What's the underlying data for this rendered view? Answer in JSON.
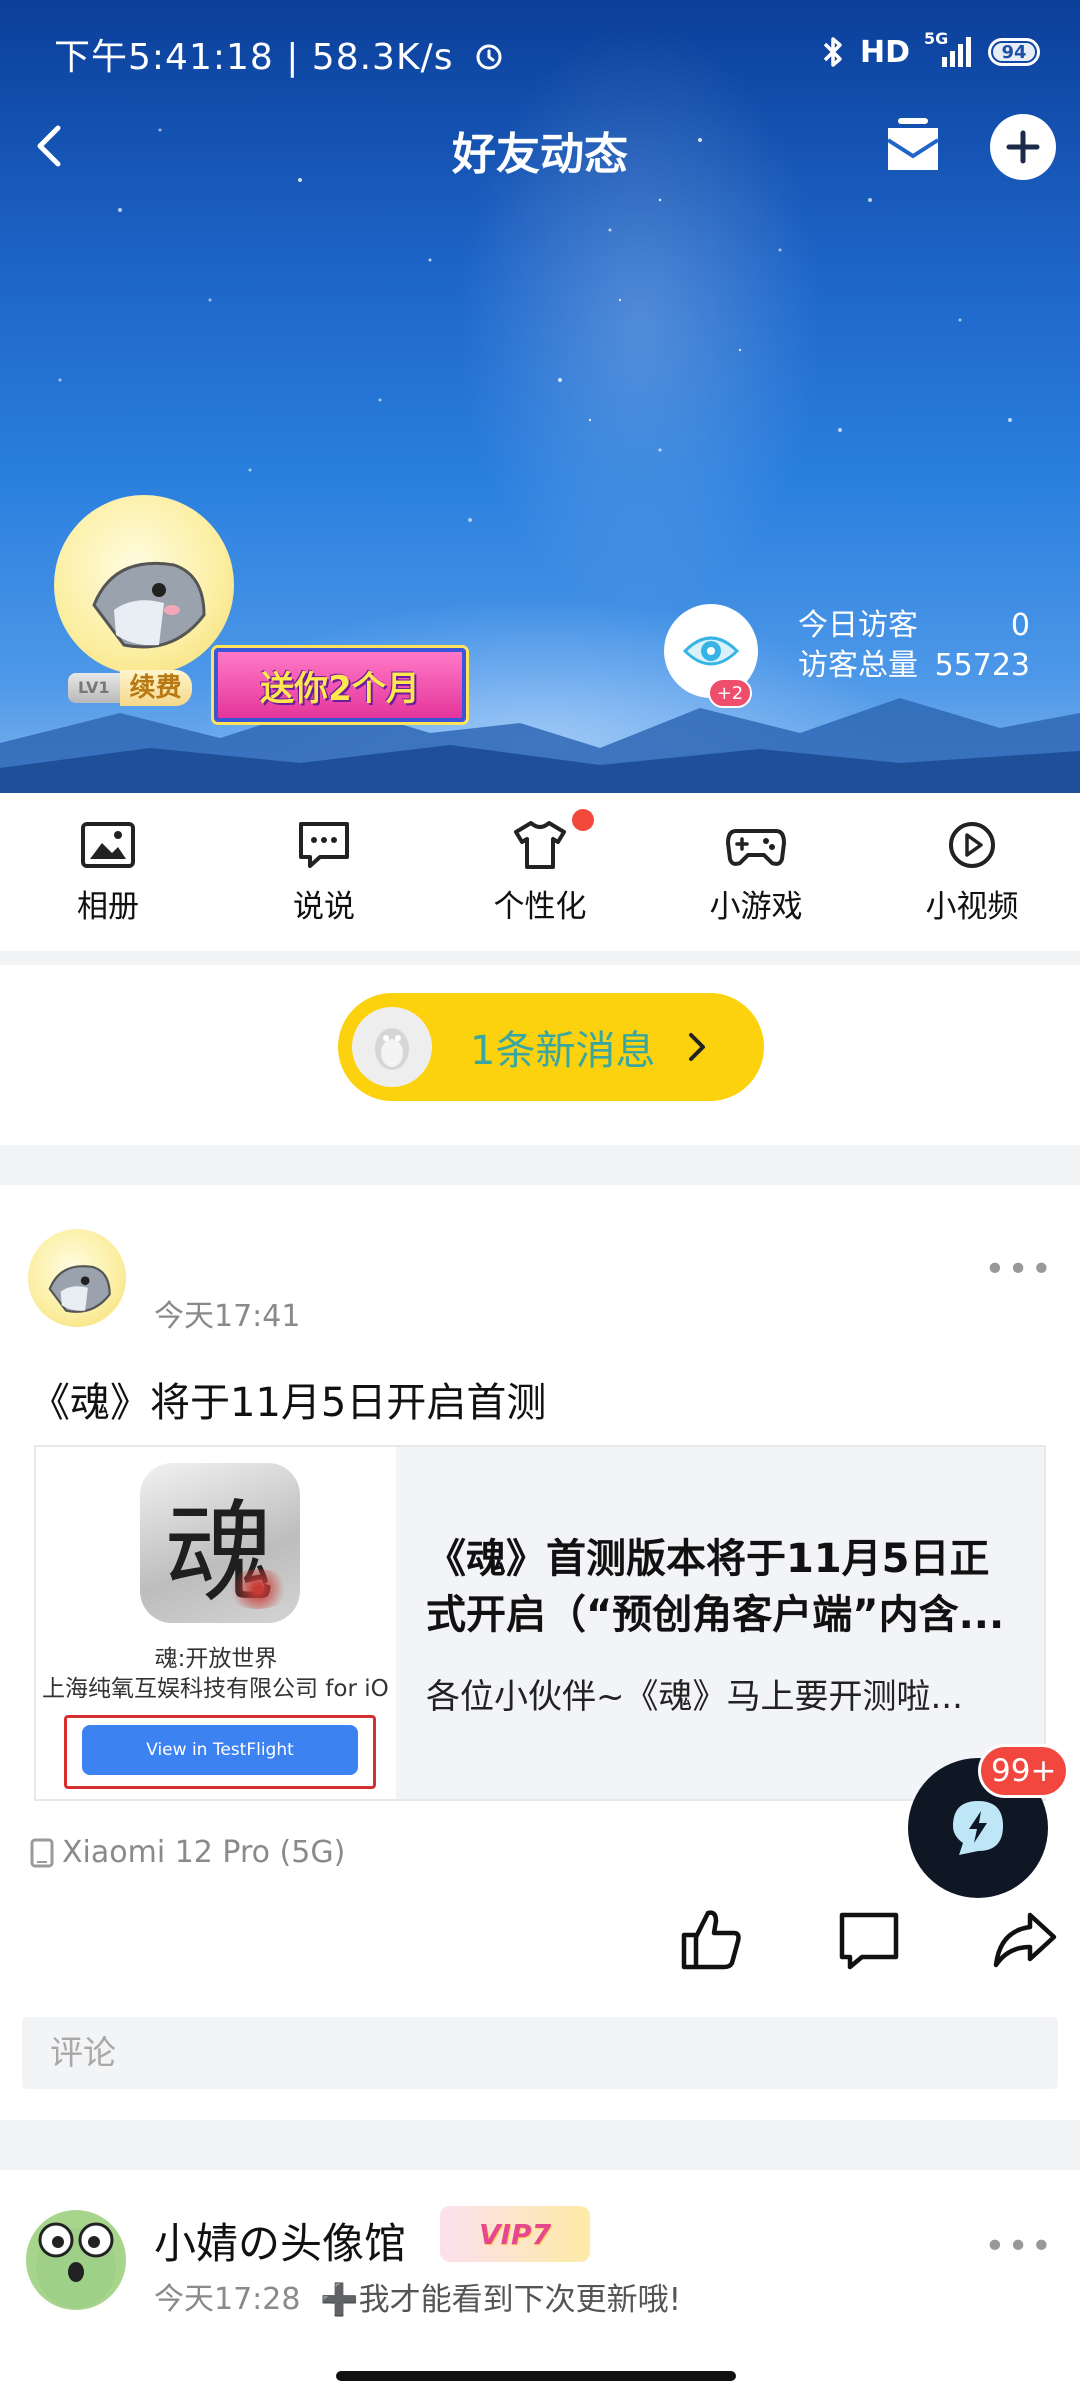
{
  "status_bar": {
    "time_speed": "下午5:41:18 | 58.3K/s",
    "alarm_icon": "alarm-icon",
    "bluetooth_icon": "bluetooth-icon",
    "hd_label": "HD",
    "signal_label": "5G",
    "battery": "94"
  },
  "nav": {
    "title": "好友动态",
    "back_icon": "chevron-left-icon",
    "mail_icon": "mail-icon",
    "add_icon": "plus-circle-icon"
  },
  "profile": {
    "level": "LV1",
    "renew_label": "续费",
    "gift_label": "送你2个月",
    "visitor_badge": "+2",
    "today_visitors_label": "今日访客",
    "today_visitors_value": "0",
    "total_visitors_label": "访客总量",
    "total_visitors_value": "55723"
  },
  "quick_menu": [
    {
      "label": "相册",
      "icon": "photo-album-icon"
    },
    {
      "label": "说说",
      "icon": "chat-bubble-icon"
    },
    {
      "label": "个性化",
      "icon": "t-shirt-icon"
    },
    {
      "label": "小游戏",
      "icon": "gamepad-icon"
    },
    {
      "label": "小视频",
      "icon": "play-circle-icon"
    }
  ],
  "new_message": {
    "label": "1条新消息"
  },
  "post": {
    "time": "今天17:41",
    "text": "《魂》将于11月5日开启首测",
    "card": {
      "app_glyph": "魂",
      "app_name": "魂:开放世界",
      "company": "上海纯氧互娱科技有限公司 for iO",
      "button": "View in TestFlight",
      "title": "《魂》首测版本将于11月5日正式开启（“预创角客户端”内含...",
      "desc": "各位小伙伴~《魂》马上要开测啦..."
    },
    "device": "Xiaomi 12 Pro (5G)",
    "comment_placeholder": "评论"
  },
  "float": {
    "badge": "99+"
  },
  "post2": {
    "name": "小婧の头像馆",
    "vip_label": "VIP7",
    "time": "今天17:28",
    "signature": "➕我才能看到下次更新哦!"
  },
  "colors": {
    "accent_yellow": "#fcd10e",
    "message_text": "#3aa6a0",
    "badge_red": "#f2473e"
  }
}
